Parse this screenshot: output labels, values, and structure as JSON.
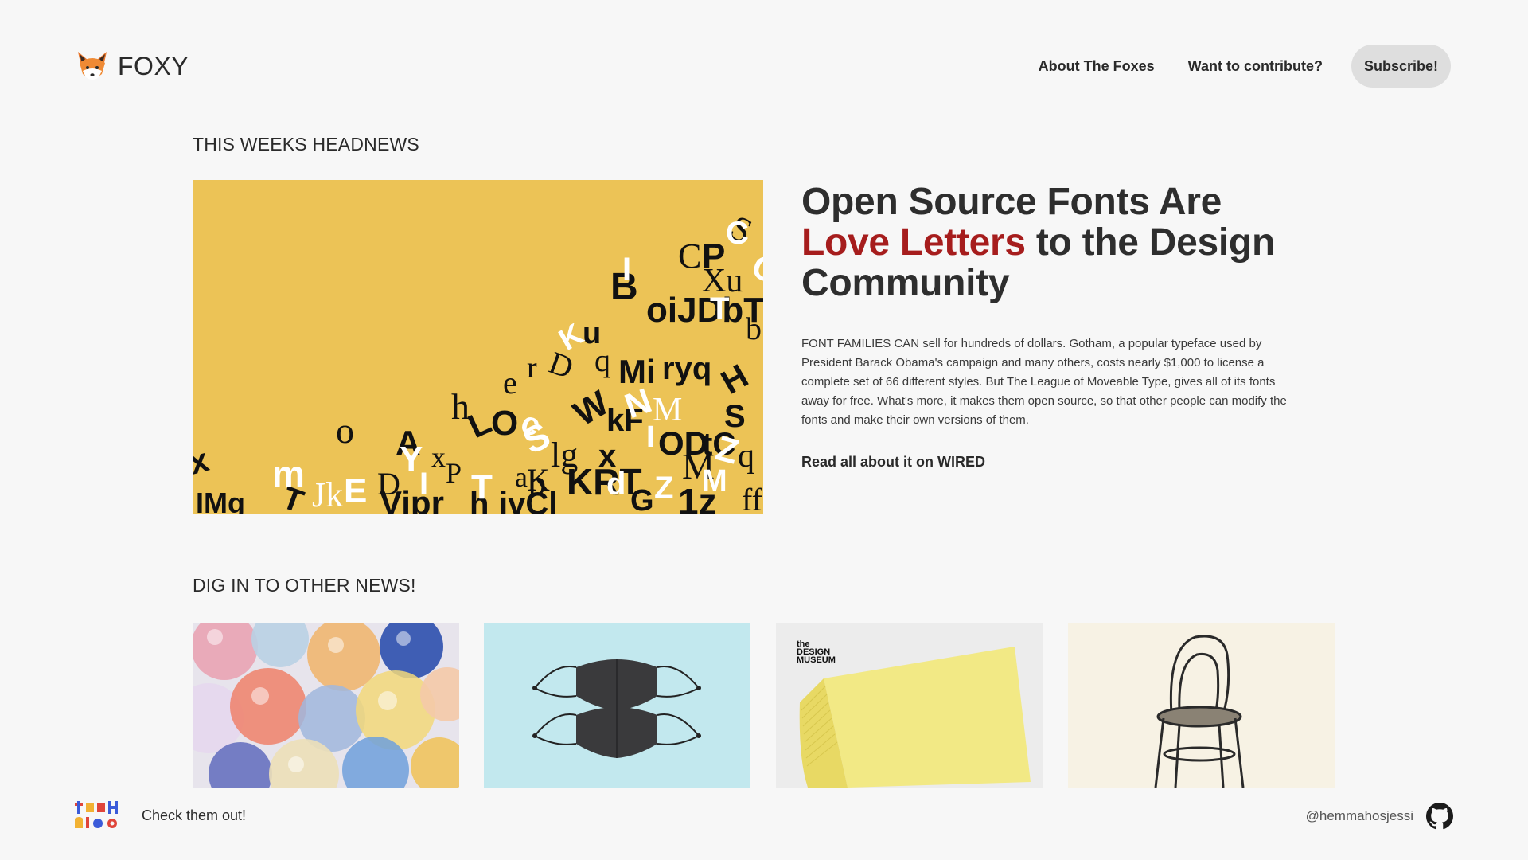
{
  "brand": {
    "name": "FOXY",
    "logo_icon": "fox-face-icon"
  },
  "nav": {
    "about_label": "About The Foxes",
    "contribute_label": "Want to contribute?",
    "subscribe_label": "Subscribe!"
  },
  "headnews": {
    "section_title": "THIS WEEKS HEADNEWS",
    "headline_part1": "Open Source Fonts Are ",
    "headline_accent": "Love Letters",
    "headline_part2": " to the Design Community",
    "body": "FONT FAMILIES CAN sell for hundreds of dollars. Gotham, a popular typeface used by President Barack Obama's campaign and many others, costs nearly $1,000 to license a complete set of 66 different styles. But The League of Moveable Type, gives all of its fonts away for free. What's more, it makes them open source, so that other people can modify the fonts and make their own versions of them.",
    "read_more_label": "Read all about it on WIRED"
  },
  "other_news": {
    "section_title": "DIG IN TO OTHER NEWS!",
    "thumbnails": [
      {
        "icon": "glass-marbles-image"
      },
      {
        "icon": "face-masks-image"
      },
      {
        "icon": "sticky-notes-image",
        "caption_line1": "the",
        "caption_line2": "DESIGN",
        "caption_line3": "MUSEUM"
      },
      {
        "icon": "bentwood-chair-image"
      }
    ]
  },
  "footer": {
    "cta_text": "Check them out!",
    "handle": "@hemmahosjessi",
    "techmeco_icon": "techmeco-logo-icon",
    "github_icon": "github-icon"
  },
  "colors": {
    "background": "#f7f7f7",
    "accent": "#a61d1d",
    "hero_bg": "#ecc356",
    "subscribe_bg": "#dedede"
  }
}
